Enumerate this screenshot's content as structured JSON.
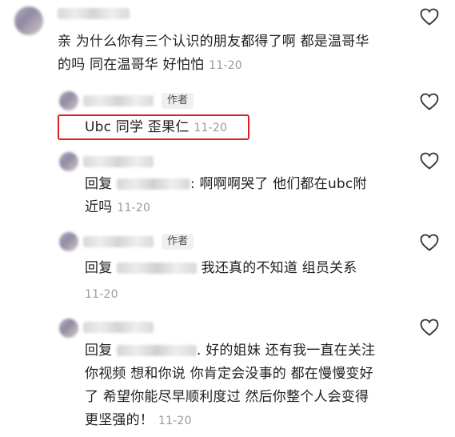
{
  "comments": [
    {
      "line1": "亲 为什么你有三个认识的朋友都得了啊 都是温哥华",
      "line2": "的吗 同在温哥华 好怕怕",
      "time": "11-20"
    },
    {
      "author_tag": "作者",
      "text": "Ubc 同学 歪果仁",
      "time": "11-20"
    },
    {
      "reply_prefix": "回复",
      "line1": ": 啊啊啊哭了 他们都在ubc附",
      "line2": "近吗",
      "time": "11-20"
    },
    {
      "author_tag": "作者",
      "reply_prefix": "回复",
      "line1": "我还真的不知道 组员关系",
      "time": "11-20"
    },
    {
      "reply_prefix": "回复",
      "line1": ". 好的姐妹 还有我一直在关注",
      "line2": "你视频 想和你说 你肯定会没事的 都在慢慢变好",
      "line3": "了 希望你能尽早顺利度过 然后你整个人会变得",
      "line4": "更坚强的！",
      "time": "11-20"
    }
  ],
  "colors": {
    "highlight": "#e02020",
    "time": "#9a9a9a"
  },
  "icons": {
    "like": "heart-icon"
  }
}
